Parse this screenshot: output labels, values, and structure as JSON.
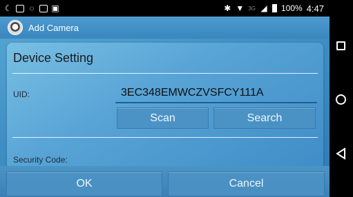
{
  "status_bar": {
    "left_icons": [
      "moon-icon",
      "gmail-icon",
      "whatsapp-icon",
      "image-icon",
      "sim-icon"
    ],
    "right_icons": [
      "bluetooth-icon",
      "wifi-icon",
      "3g-icon",
      "signal-icon",
      "battery-icon"
    ],
    "network": "3G",
    "battery": "100%",
    "time": "4:47"
  },
  "app_bar": {
    "icon": "camera-app-icon",
    "title": "Add Camera"
  },
  "card": {
    "title": "Device Setting",
    "uid_label": "UID:",
    "uid_value": "3EC348EMWCZVSFCY111A",
    "scan_label": "Scan",
    "search_label": "Search",
    "security_label": "Security Code:"
  },
  "actions": {
    "ok_label": "OK",
    "cancel_label": "Cancel"
  },
  "nav_bar": {
    "buttons": [
      "recent-apps-icon",
      "home-icon",
      "back-icon"
    ]
  },
  "colors": {
    "app_bar": "#3a86bd",
    "card": "#5aa6d8",
    "underline": "#1f5f94"
  }
}
